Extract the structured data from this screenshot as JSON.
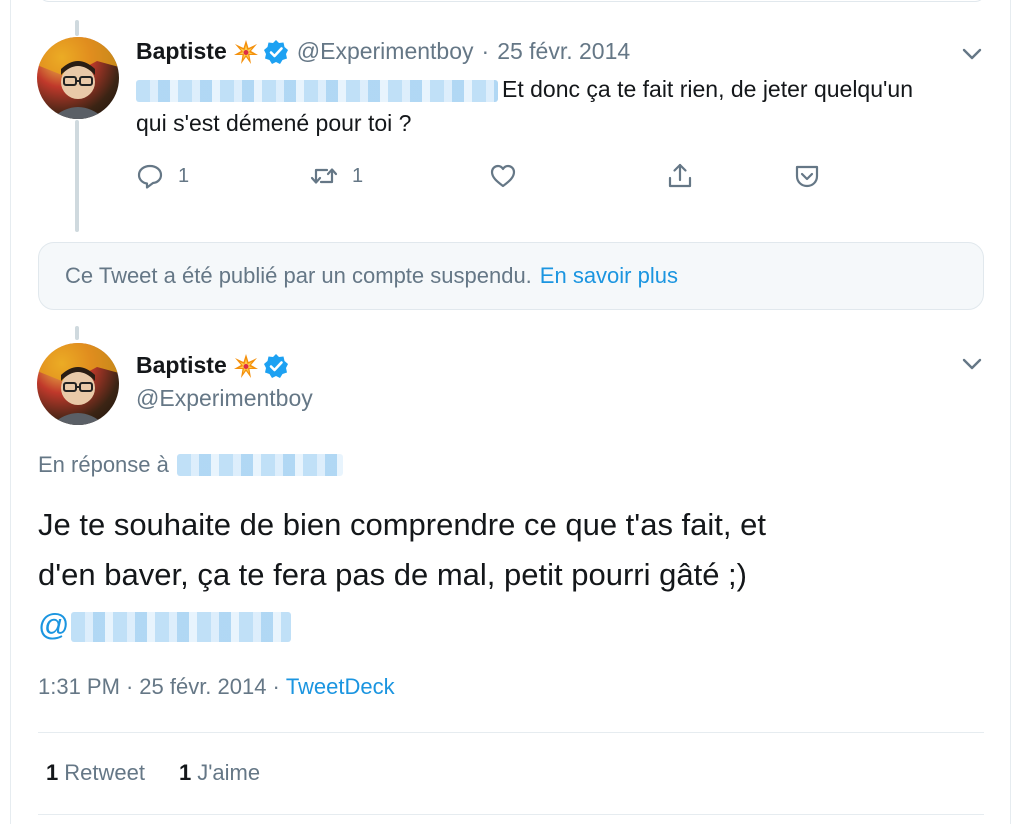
{
  "reply_tweet": {
    "display_name": "Baptiste",
    "handle": "@Experimentboy",
    "date": "25 févr. 2014",
    "text_line1": "Et donc ça te fait rien, de jeter quelqu'un",
    "text_line2": "qui s'est démené pour toi ?",
    "reply_count": "1",
    "retweet_count": "1",
    "icons": [
      "reply-icon",
      "retweet-icon",
      "like-icon",
      "share-icon",
      "caret-icon"
    ]
  },
  "suspended_notice": {
    "text": "Ce Tweet a été publié par un compte suspendu.",
    "link": "En savoir plus"
  },
  "main_tweet": {
    "display_name": "Baptiste",
    "handle": "@Experimentboy",
    "reply_prefix": "En réponse à",
    "text_line1": "Je te souhaite de bien comprendre ce que t'as fait, et",
    "text_line2": "d'en baver, ça te fera pas de mal, petit pourri gâté ;)",
    "mention_at": "@",
    "time": "1:31 PM",
    "date": "25 févr. 2014",
    "separator": "·",
    "source": "TweetDeck",
    "retweets_count": "1",
    "retweets_label": "Retweet",
    "likes_count": "1",
    "likes_label": "J'aime"
  },
  "colors": {
    "link": "#1b95e0",
    "secondary_text": "#657786",
    "verified": "#1da1f2",
    "border": "#e1e8ed"
  }
}
